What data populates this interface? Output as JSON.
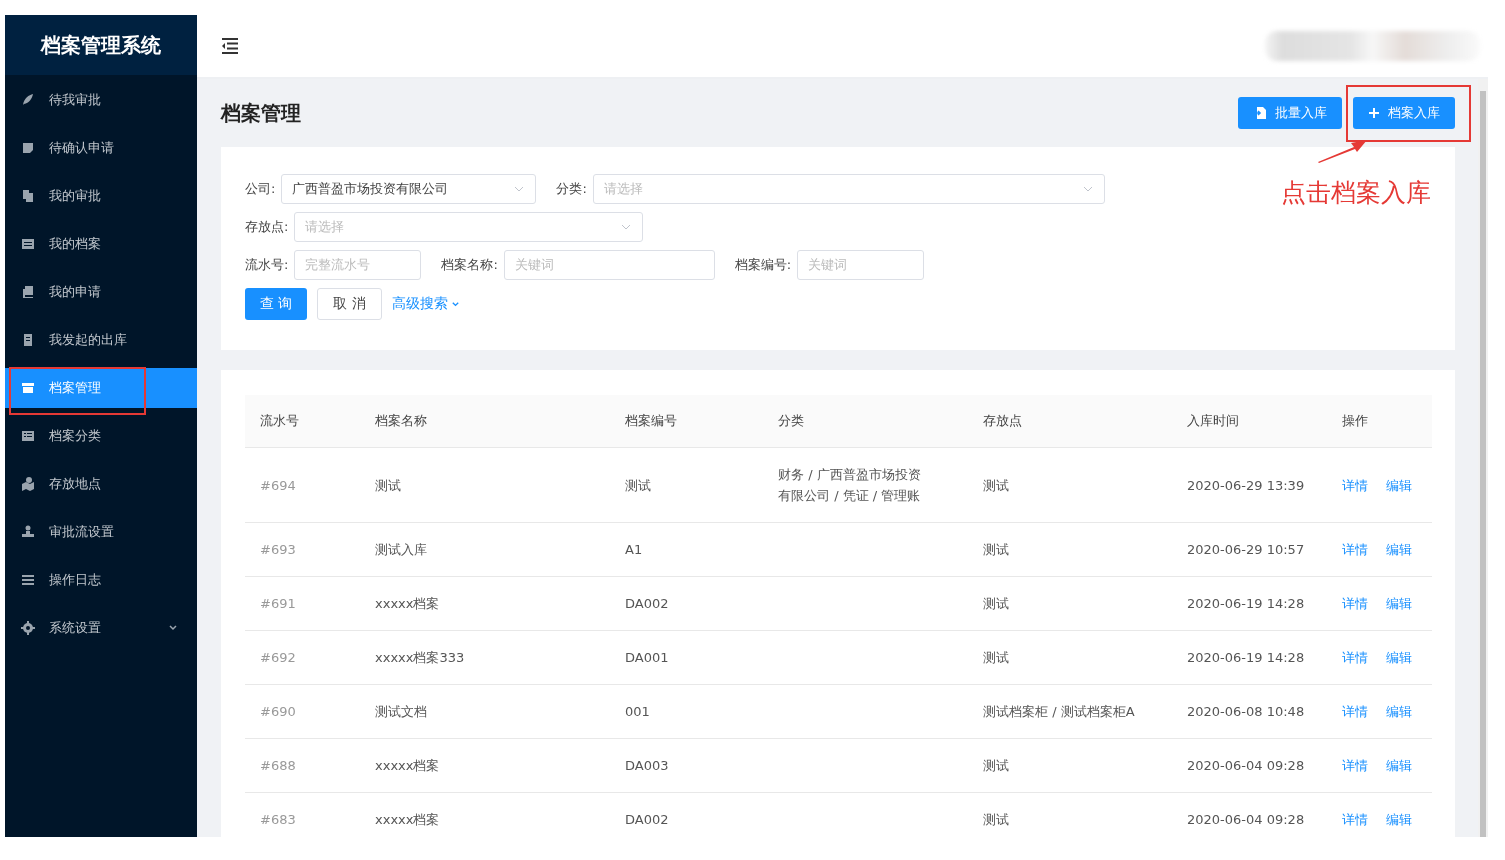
{
  "sidebar": {
    "title": "档案管理系统",
    "items": [
      {
        "label": "待我审批",
        "kind": "link",
        "selected": false
      },
      {
        "label": "待确认申请",
        "kind": "link",
        "selected": false
      },
      {
        "label": "我的审批",
        "kind": "link",
        "selected": false
      },
      {
        "label": "我的档案",
        "kind": "link",
        "selected": false
      },
      {
        "label": "我的申请",
        "kind": "link",
        "selected": false
      },
      {
        "label": "我发起的出库",
        "kind": "link",
        "selected": false
      },
      {
        "label": "档案管理",
        "kind": "link",
        "selected": true
      },
      {
        "label": "档案分类",
        "kind": "link",
        "selected": false
      },
      {
        "label": "存放地点",
        "kind": "link",
        "selected": false
      },
      {
        "label": "审批流设置",
        "kind": "link",
        "selected": false
      },
      {
        "label": "操作日志",
        "kind": "link",
        "selected": false
      },
      {
        "label": "系统设置",
        "kind": "submenu",
        "selected": false
      }
    ]
  },
  "page": {
    "title": "档案管理",
    "actions": [
      {
        "label": "批量入库",
        "kind": "import"
      },
      {
        "label": "档案入库",
        "kind": "add"
      }
    ]
  },
  "filters": {
    "rows": [
      [
        {
          "label": "公司:",
          "kind": "select",
          "value": "广西普盈市场投资有限公司"
        },
        {
          "label": "分类:",
          "kind": "select",
          "placeholder": "请选择"
        }
      ],
      [
        {
          "label": "存放点:",
          "kind": "select",
          "placeholder": "请选择"
        }
      ],
      [
        {
          "label": "流水号:",
          "kind": "input",
          "placeholder": "完整流水号"
        },
        {
          "label": "档案名称:",
          "kind": "input",
          "placeholder": "关键词"
        },
        {
          "label": "档案编号:",
          "kind": "input",
          "placeholder": "关键词"
        }
      ]
    ],
    "buttons": [
      {
        "label": "查 询",
        "kind": "primary"
      },
      {
        "label": "取 消",
        "kind": "default"
      },
      {
        "label": "高级搜索",
        "kind": "link"
      }
    ]
  },
  "table": {
    "columns": [
      "流水号",
      "档案名称",
      "档案编号",
      "分类",
      "存放点",
      "入库时间",
      "操作"
    ],
    "rows": [
      {
        "cells": [
          "#694",
          "测试",
          "测试",
          "财务 / 广西普盈市场投资有限公司 / 凭证 / 管理账",
          "测试",
          "2020-06-29 13:39"
        ],
        "actions": [
          "详情",
          "编辑"
        ]
      },
      {
        "cells": [
          "#693",
          "测试入库",
          "A1",
          "",
          "测试",
          "2020-06-29 10:57"
        ],
        "actions": [
          "详情",
          "编辑"
        ]
      },
      {
        "cells": [
          "#691",
          "xxxxx档案",
          "DA002",
          "",
          "测试",
          "2020-06-19 14:28"
        ],
        "actions": [
          "详情",
          "编辑"
        ]
      },
      {
        "cells": [
          "#692",
          "xxxxx档案333",
          "DA001",
          "",
          "测试",
          "2020-06-19 14:28"
        ],
        "actions": [
          "详情",
          "编辑"
        ]
      },
      {
        "cells": [
          "#690",
          "测试文档",
          "001",
          "",
          "测试档案柜 / 测试档案柜A",
          "2020-06-08 10:48"
        ],
        "actions": [
          "详情",
          "编辑"
        ]
      },
      {
        "cells": [
          "#688",
          "xxxxx档案",
          "DA003",
          "",
          "测试",
          "2020-06-04 09:28"
        ],
        "actions": [
          "详情",
          "编辑"
        ]
      },
      {
        "cells": [
          "#683",
          "xxxxx档案",
          "DA002",
          "",
          "测试",
          "2020-06-04 09:28"
        ],
        "actions": [
          "详情",
          "编辑"
        ]
      }
    ]
  },
  "annotation": {
    "text": "点击档案入库"
  }
}
